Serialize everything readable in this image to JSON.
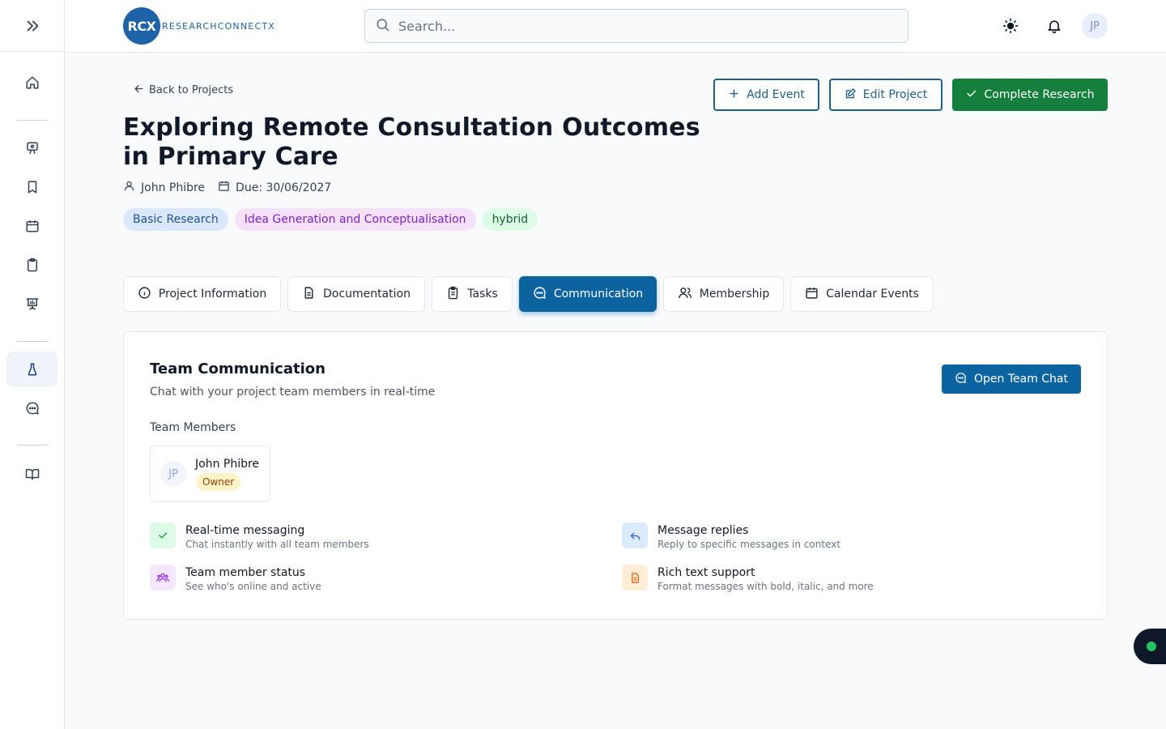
{
  "app": {
    "logo_initials": "RCX",
    "logo_name": "RESEARCHCONNECTX"
  },
  "header": {
    "search": {
      "placeholder": "Search...",
      "value": ""
    },
    "user_initials": "JP"
  },
  "sidebar": {
    "toggle_icon": "double-chevron-right-icon",
    "items": [
      {
        "icon": "home-icon",
        "active": false
      },
      {
        "icon": "teacher-board-icon",
        "active": false
      },
      {
        "icon": "bookmark-icon",
        "active": false
      },
      {
        "icon": "calendar-icon",
        "active": false
      },
      {
        "icon": "clipboard-icon",
        "active": false
      },
      {
        "icon": "presentation-chart-icon",
        "active": false
      },
      {
        "icon": "flask-icon",
        "active": true
      },
      {
        "icon": "chat-bubble-icon",
        "active": false
      },
      {
        "icon": "open-book-icon",
        "active": false
      }
    ]
  },
  "project": {
    "back_label": "Back to Projects",
    "title": "Exploring Remote Consultation Outcomes in Primary Care",
    "owner": "John Phibre",
    "due": "Due: 30/06/2027",
    "tags": [
      {
        "label": "Basic Research",
        "bg": "#dbe7fb",
        "color": "#1e4f9a"
      },
      {
        "label": "Idea Generation and Conceptualisation",
        "bg": "#f5e1fa",
        "color": "#7e22ce"
      },
      {
        "label": "hybrid",
        "bg": "#dcfce7",
        "color": "#166534"
      }
    ]
  },
  "actions": {
    "add_event": "Add Event",
    "edit_project": "Edit Project",
    "complete_research": "Complete Research"
  },
  "tabs": [
    {
      "label": "Project Information",
      "icon": "info-circle-icon",
      "active": false
    },
    {
      "label": "Documentation",
      "icon": "document-icon",
      "active": false
    },
    {
      "label": "Tasks",
      "icon": "clipboard-list-icon",
      "active": false
    },
    {
      "label": "Communication",
      "icon": "chat-bubble-icon",
      "active": true
    },
    {
      "label": "Membership",
      "icon": "users-icon",
      "active": false
    },
    {
      "label": "Calendar Events",
      "icon": "calendar-icon",
      "active": false
    }
  ],
  "communication": {
    "title": "Team Communication",
    "subtitle": "Chat with your project team members in real-time",
    "open_chat": "Open Team Chat",
    "members_label": "Team Members",
    "members": [
      {
        "initials": "JP",
        "name": "John Phibre",
        "role": "Owner"
      }
    ],
    "features": [
      {
        "title": "Real-time messaging",
        "desc": "Chat instantly with all team members",
        "icon": "check-icon",
        "bg": "#dcfce7",
        "color": "#16a34a"
      },
      {
        "title": "Message replies",
        "desc": "Reply to specific messages in context",
        "icon": "reply-arrow-icon",
        "bg": "#dbeafe",
        "color": "#2563eb"
      },
      {
        "title": "Team member status",
        "desc": "See who's online and active",
        "icon": "users-icon",
        "bg": "#f3e8ff",
        "color": "#9333ea"
      },
      {
        "title": "Rich text support",
        "desc": "Format messages with bold, italic, and more",
        "icon": "document-icon",
        "bg": "#ffedd5",
        "color": "#ea580c"
      }
    ]
  },
  "status_widget": {
    "status_color": "#22c55e"
  }
}
